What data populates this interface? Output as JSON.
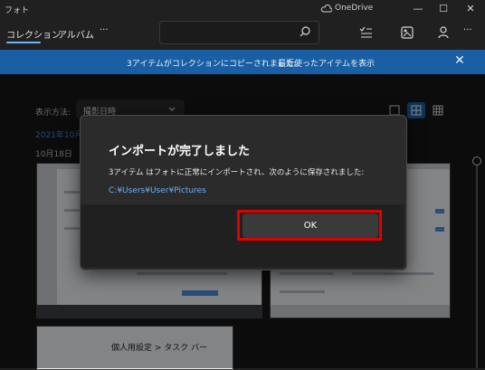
{
  "window": {
    "app_title": "フォト",
    "onedrive_label": "OneDrive",
    "minimize": "—",
    "maximize": "☐",
    "close": "✕"
  },
  "nav": {
    "tabs": [
      {
        "label": "コレクション",
        "selected": true
      },
      {
        "label": "アルバム",
        "selected": false
      }
    ],
    "more": "···",
    "search_placeholder": "",
    "toolbar_more": "···"
  },
  "banner": {
    "message": "3アイテムがコレクションにコピーされました。",
    "link": "最近使ったアイテムを表示",
    "close": "✕"
  },
  "content": {
    "sort_label": "表示方法:",
    "sort_value": "撮影日時",
    "date_month": "2021年10月",
    "date_day": "10月18日"
  },
  "dialog": {
    "title": "インポートが完了しました",
    "message": "3アイテム はフォトに正常にインポートされ、次のように保存されました:",
    "path": "C:¥Users¥User¥Pictures",
    "ok_label": "OK"
  },
  "thumbnails": {
    "settings_title": "個人用設定 > タスク バー"
  },
  "colors": {
    "accent": "#1a5fa3",
    "link": "#66b3ff",
    "highlight": "#e00000"
  }
}
